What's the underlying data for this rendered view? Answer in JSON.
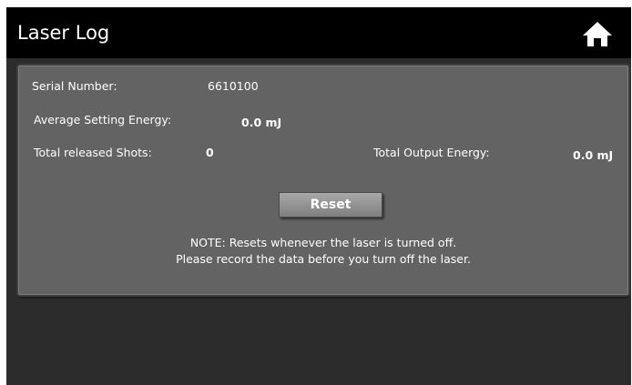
{
  "header": {
    "title": "Laser Log",
    "home_icon": "home-icon"
  },
  "panel": {
    "serial_label": "Serial Number:",
    "serial_value": "6610100",
    "avg_energy_label": "Average Setting Energy:",
    "avg_energy_value": "0.0 mJ",
    "shots_label": "Total released Shots:",
    "shots_value": "0",
    "output_label": "Total Output Energy:",
    "output_value": "0.0 mJ",
    "reset_label": "Reset",
    "note_line1": "NOTE: Resets whenever the laser is turned off.",
    "note_line2": "Please record the data before you turn off the laser."
  },
  "colors": {
    "background": "#2c2c2c",
    "titlebar": "#000000",
    "panel": "#636363",
    "button": "#8f8f8f"
  }
}
